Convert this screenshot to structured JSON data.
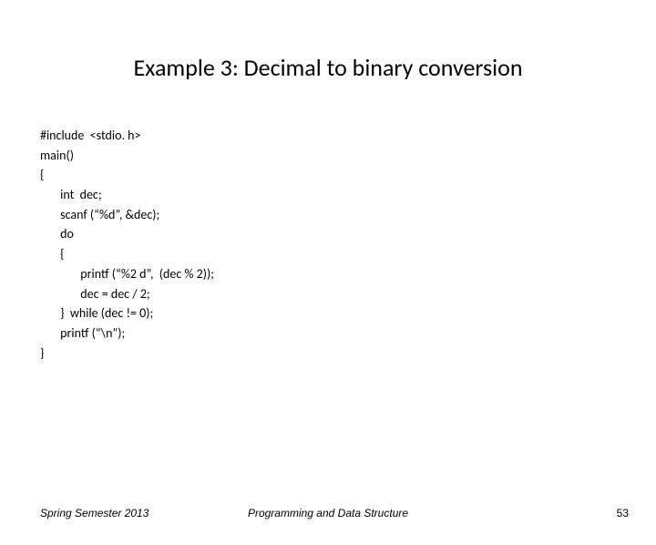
{
  "title": "Example 3: Decimal to binary conversion",
  "code": {
    "l0": "#include  <stdio. h>",
    "l1": "main()",
    "l2": "{",
    "l3": "       int  dec;",
    "l4": "       scanf (“%d”, &dec);",
    "l5": "       do",
    "l6": "       {",
    "l7": "              printf (“%2 d”,  (dec % 2));",
    "l8": "              dec = dec / 2;",
    "l9": "       }  while (dec != 0);",
    "l10": "       printf (“\\n”);",
    "l11": "}"
  },
  "footer": {
    "left": "Spring Semester 2013",
    "center": "Programming and Data Structure",
    "right": "53"
  }
}
